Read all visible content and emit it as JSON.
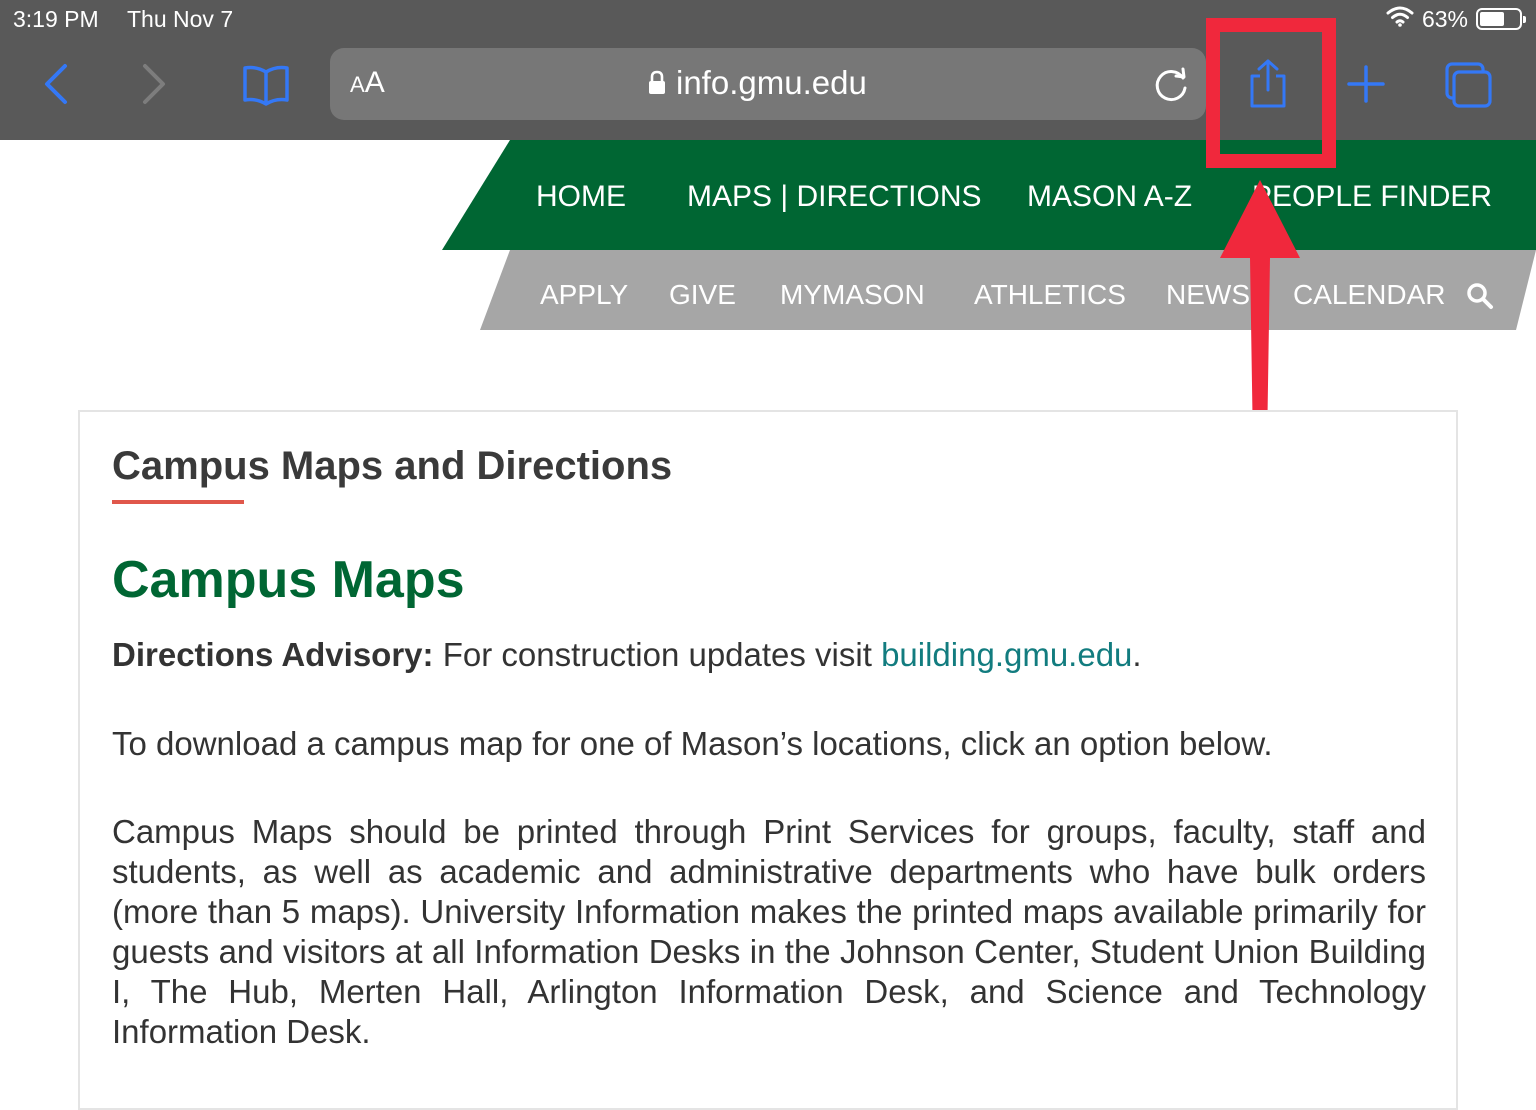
{
  "status_bar": {
    "time": "3:19 PM",
    "date": "Thu Nov 7",
    "battery_percent": "63%",
    "battery_level": 0.63
  },
  "browser": {
    "aa_label_small": "A",
    "aa_label_large": "A",
    "url": "info.gmu.edu",
    "accent_color": "#3478f6",
    "highlight_color": "#f0283c"
  },
  "primary_nav": {
    "items": [
      "HOME",
      "MAPS | DIRECTIONS",
      "MASON A-Z",
      "PEOPLE FINDER"
    ],
    "color": "#006633"
  },
  "secondary_nav": {
    "items": [
      "APPLY",
      "GIVE",
      "MYMASON",
      "ATHLETICS",
      "NEWS",
      "CALENDAR"
    ],
    "color": "#a6a6a6"
  },
  "content": {
    "section_title": "Campus Maps and Directions",
    "heading": "Campus Maps",
    "advisory_label": "Directions Advisory:",
    "advisory_text": " For construction updates visit ",
    "advisory_link": "building.gmu.edu",
    "advisory_end": ".",
    "download_text": "To download a campus map for one of Mason’s locations, click an option below.",
    "print_text": "Campus Maps should be printed through Print Services for groups, faculty, staff and students, as well as academic and administrative departments who have bulk orders (more than 5 maps). University Information makes the printed maps available primarily for guests and visitors at all Information Desks in the Johnson Center, Student Union Building I, The Hub, Merten Hall, Arlington Information Desk, and Science and Technology Information Desk."
  }
}
